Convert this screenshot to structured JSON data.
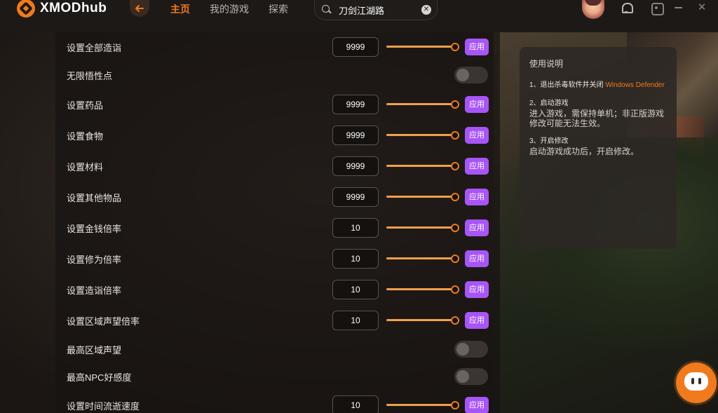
{
  "app": {
    "logo_text": "XMODhub"
  },
  "nav": {
    "items": [
      "主页",
      "我的游戏",
      "探索"
    ],
    "active": "主页"
  },
  "search": {
    "value": "刀剑江湖路"
  },
  "rows": [
    {
      "label": "设置全部造诣",
      "type": "number",
      "value": "9999",
      "apply": "应用"
    },
    {
      "label": "无限悟性点",
      "type": "toggle"
    },
    {
      "label": "设置药品",
      "type": "number",
      "value": "9999",
      "apply": "应用"
    },
    {
      "label": "设置食物",
      "type": "number",
      "value": "9999",
      "apply": "应用"
    },
    {
      "label": "设置材料",
      "type": "number",
      "value": "9999",
      "apply": "应用"
    },
    {
      "label": "设置其他物品",
      "type": "number",
      "value": "9999",
      "apply": "应用"
    },
    {
      "label": "设置金钱倍率",
      "type": "number",
      "value": "10",
      "apply": "应用"
    },
    {
      "label": "设置修为倍率",
      "type": "number",
      "value": "10",
      "apply": "应用"
    },
    {
      "label": "设置造诣倍率",
      "type": "number",
      "value": "10",
      "apply": "应用"
    },
    {
      "label": "设置区域声望倍率",
      "type": "number",
      "value": "10",
      "apply": "应用"
    },
    {
      "label": "最高区域声望",
      "type": "toggle"
    },
    {
      "label": "最高NPC好感度",
      "type": "toggle"
    },
    {
      "label": "设置时间流逝速度",
      "type": "number",
      "value": "10",
      "apply": "应用"
    }
  ],
  "info": {
    "title": "使用说明",
    "steps": [
      {
        "head": "1、退出杀毒软件并关闭",
        "head_highlight": "Windows Defender",
        "body": ""
      },
      {
        "head": "2、启动游戏",
        "head_highlight": "",
        "body": "进入游戏，需保持单机；非正版游戏修改可能无法生效。"
      },
      {
        "head": "3、开启修改",
        "head_highlight": "",
        "body": "启动游戏成功后，开启修改。"
      }
    ]
  },
  "colors": {
    "accent": "#f07a1e",
    "apply_button": "#a855f7",
    "slider": "#f0a14a"
  },
  "icons": [
    "back-arrow-icon",
    "search-icon",
    "clear-icon",
    "avatar",
    "bell-icon",
    "settings-icon",
    "minimize-icon",
    "close-icon",
    "mascot-icon"
  ]
}
